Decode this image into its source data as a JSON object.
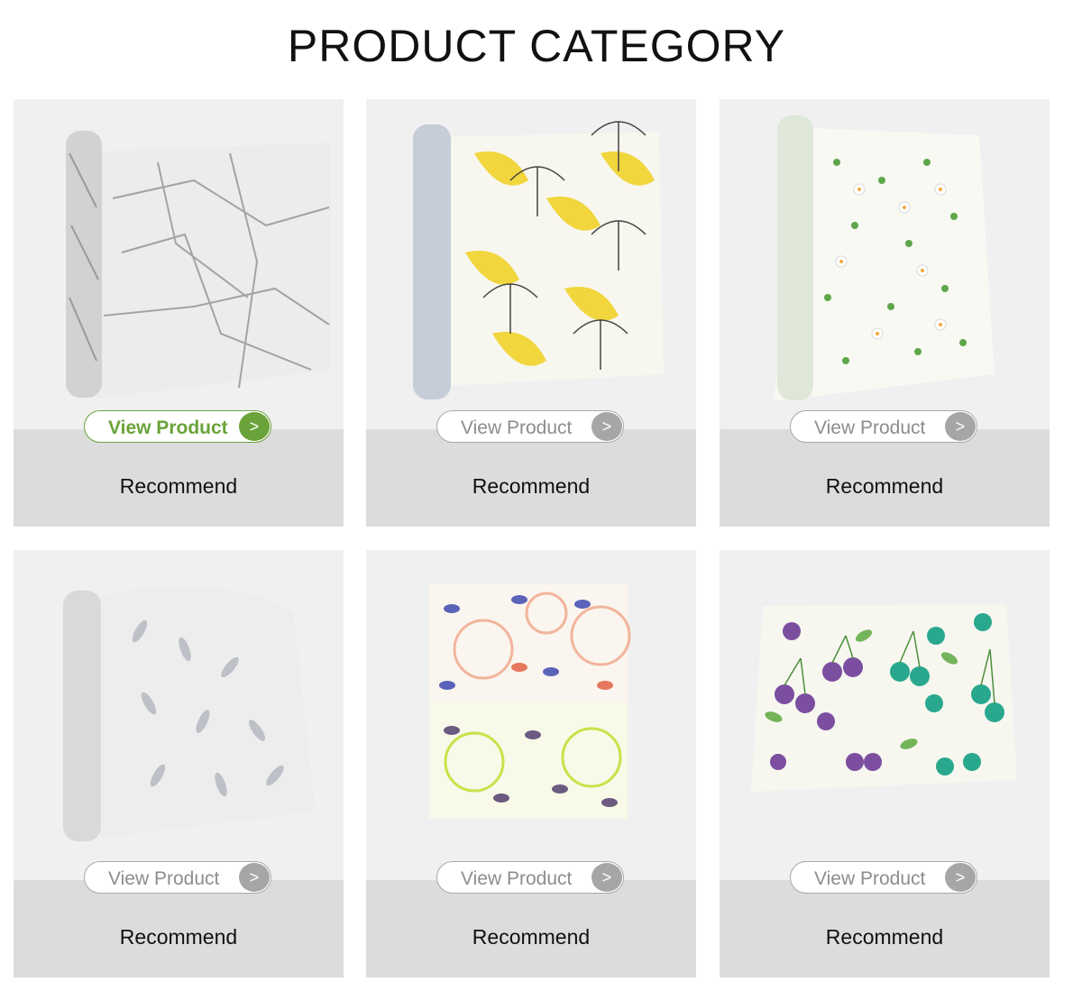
{
  "page": {
    "title": "PRODUCT CATEGORY"
  },
  "products": [
    {
      "button_label": "View Product",
      "arrow": ">",
      "caption": "Recommend",
      "pattern": "marble"
    },
    {
      "button_label": "View Product",
      "arrow": ">",
      "caption": "Recommend",
      "pattern": "ginkgo"
    },
    {
      "button_label": "View Product",
      "arrow": ">",
      "caption": "Recommend",
      "pattern": "daisy"
    },
    {
      "button_label": "View Product",
      "arrow": ">",
      "caption": "Recommend",
      "pattern": "feather"
    },
    {
      "button_label": "View Product",
      "arrow": ">",
      "caption": "Recommend",
      "pattern": "citrus floral"
    },
    {
      "button_label": "View Product",
      "arrow": ">",
      "caption": "Recommend",
      "pattern": "cherry"
    }
  ],
  "colors": {
    "accent": "#6aa33a",
    "card_bg": "#f0f0f0",
    "card_band": "#dcdcdc",
    "button_gray": "#a6a6a6"
  }
}
